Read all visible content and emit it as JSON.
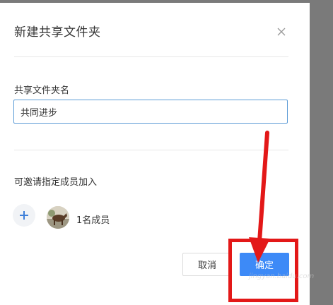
{
  "dialog": {
    "title": "新建共享文件夹",
    "close_icon": "close-icon"
  },
  "folder_name": {
    "label": "共享文件夹名",
    "value": "共同进步"
  },
  "invite": {
    "label": "可邀请指定成员加入",
    "add_icon": "plus-icon",
    "member_count": "1名成员"
  },
  "actions": {
    "cancel_label": "取消",
    "confirm_label": "确定"
  },
  "annotation": {
    "color": "#e31818"
  },
  "colors": {
    "primary": "#3d8af7",
    "input_border": "#5b9bd6",
    "backdrop": "#7a7a7a"
  }
}
